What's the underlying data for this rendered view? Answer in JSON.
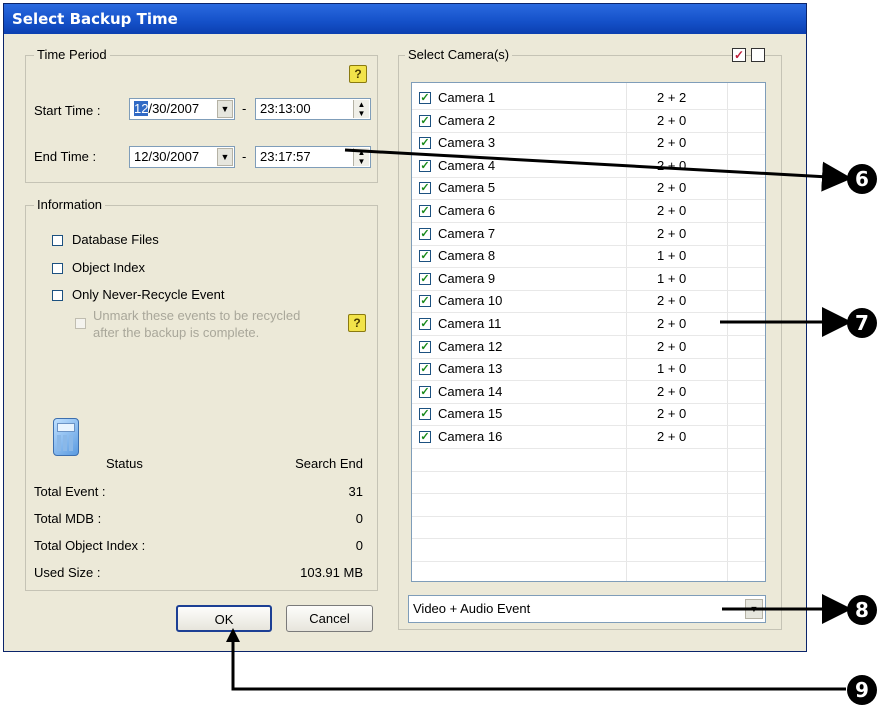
{
  "window": {
    "title": "Select Backup Time"
  },
  "time_period": {
    "legend": "Time Period",
    "help_icon": "question-icon",
    "start_label": "Start Time :",
    "start_date_sel": "12",
    "start_date_rest": "/30/2007",
    "start_time": "23:13:00",
    "end_label": "End Time :",
    "end_date": "12/30/2007",
    "end_time": "23:17:57",
    "dash": "-"
  },
  "information": {
    "legend": "Information",
    "options": [
      {
        "label": "Database Files",
        "checked": false
      },
      {
        "label": "Object Index",
        "checked": false
      },
      {
        "label": "Only Never-Recycle Event",
        "checked": false
      }
    ],
    "disabled_option_line1": "Unmark these events to be recycled",
    "disabled_option_line2": "after the backup is complete.",
    "status_label": "Status",
    "status_value": "Search End",
    "stats": [
      {
        "label": "Total Event :",
        "value": "31"
      },
      {
        "label": "Total MDB :",
        "value": "0"
      },
      {
        "label": "Total Object Index :",
        "value": "0"
      },
      {
        "label": "Used Size :",
        "value": "103.91 MB"
      }
    ],
    "status_icon": "calculator-icon"
  },
  "buttons": {
    "ok": "OK",
    "cancel": "Cancel"
  },
  "cameras": {
    "legend": "Select Camera(s)",
    "select_all_icon": "check-all-icon",
    "clear_all_icon": "uncheck-all-icon",
    "items": [
      {
        "name": "Camera 1",
        "streams": "2 + 2",
        "checked": true
      },
      {
        "name": "Camera 2",
        "streams": "2 + 0",
        "checked": true
      },
      {
        "name": "Camera 3",
        "streams": "2 + 0",
        "checked": true
      },
      {
        "name": "Camera 4",
        "streams": "2 + 0",
        "checked": true
      },
      {
        "name": "Camera 5",
        "streams": "2 + 0",
        "checked": true
      },
      {
        "name": "Camera 6",
        "streams": "2 + 0",
        "checked": true
      },
      {
        "name": "Camera 7",
        "streams": "2 + 0",
        "checked": true
      },
      {
        "name": "Camera 8",
        "streams": "1 + 0",
        "checked": true
      },
      {
        "name": "Camera 9",
        "streams": "1 + 0",
        "checked": true
      },
      {
        "name": "Camera 10",
        "streams": "2 + 0",
        "checked": true
      },
      {
        "name": "Camera 11",
        "streams": "2 + 0",
        "checked": true
      },
      {
        "name": "Camera 12",
        "streams": "2 + 0",
        "checked": true
      },
      {
        "name": "Camera 13",
        "streams": "1 + 0",
        "checked": true
      },
      {
        "name": "Camera 14",
        "streams": "2 + 0",
        "checked": true
      },
      {
        "name": "Camera 15",
        "streams": "2 + 0",
        "checked": true
      },
      {
        "name": "Camera 16",
        "streams": "2 + 0",
        "checked": true
      }
    ],
    "event_type": "Video + Audio Event"
  },
  "callouts": [
    "6",
    "7",
    "8",
    "9"
  ]
}
